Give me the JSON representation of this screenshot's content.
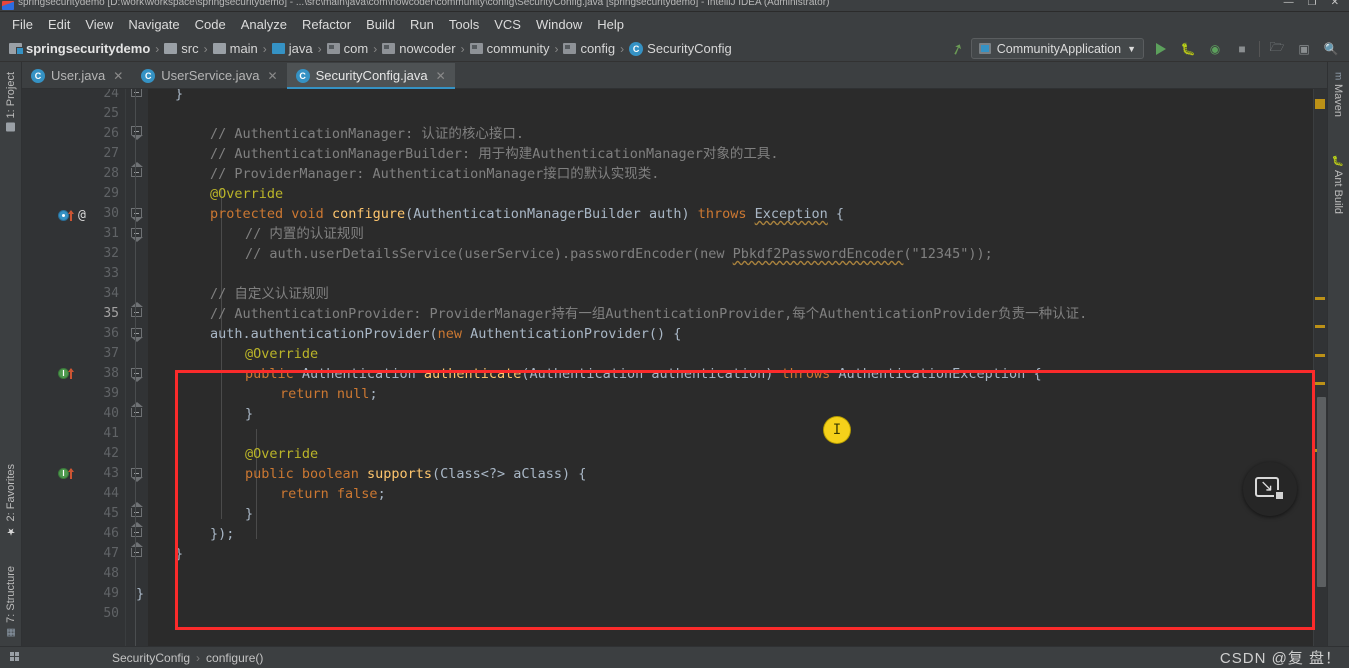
{
  "window": {
    "title": "springsecuritydemo [D:\\work\\workspace\\springsecuritydemo] - ...\\src\\main\\java\\com\\nowcoder\\community\\config\\SecurityConfig.java [springsecuritydemo] - IntelliJ IDEA (Administrator)",
    "minimize": "—",
    "maximize": "❐",
    "close": "✕"
  },
  "menu": [
    {
      "label": "File"
    },
    {
      "label": "Edit"
    },
    {
      "label": "View"
    },
    {
      "label": "Navigate"
    },
    {
      "label": "Code"
    },
    {
      "label": "Analyze"
    },
    {
      "label": "Refactor"
    },
    {
      "label": "Build"
    },
    {
      "label": "Run"
    },
    {
      "label": "Tools"
    },
    {
      "label": "VCS"
    },
    {
      "label": "Window"
    },
    {
      "label": "Help"
    }
  ],
  "breadcrumbs": [
    {
      "label": "springsecuritydemo",
      "icon": "project-folder-icon"
    },
    {
      "label": "src",
      "icon": "folder-icon"
    },
    {
      "label": "main",
      "icon": "folder-icon"
    },
    {
      "label": "java",
      "icon": "source-folder-icon"
    },
    {
      "label": "com",
      "icon": "package-icon"
    },
    {
      "label": "nowcoder",
      "icon": "package-icon"
    },
    {
      "label": "community",
      "icon": "package-icon"
    },
    {
      "label": "config",
      "icon": "package-icon"
    },
    {
      "label": "SecurityConfig",
      "icon": "class-icon"
    }
  ],
  "breadcrumb_separator": "›",
  "toolbar": {
    "build_icon": "hammer-icon",
    "run_config": "CommunityApplication",
    "run_config_caret": "▼",
    "run_icon": "run-icon",
    "debug_icon": "debug-icon",
    "coverage_icon": "run-with-coverage-icon",
    "stop_icon": "stop-icon",
    "project_structure_icon": "project-structure-icon",
    "terminal_icon": "terminal-icon",
    "search_icon": "search-everywhere-icon"
  },
  "tabs": [
    {
      "label": "User.java",
      "active": false,
      "close": "✕",
      "badge": "C"
    },
    {
      "label": "UserService.java",
      "active": false,
      "close": "✕",
      "badge": "C"
    },
    {
      "label": "SecurityConfig.java",
      "active": true,
      "close": "✕",
      "badge": "C"
    }
  ],
  "left_tool_window": [
    {
      "label": "1: Project",
      "icon": "project-icon"
    },
    {
      "label": "2: Favorites",
      "icon": "star-icon"
    },
    {
      "label": "7: Structure",
      "icon": "structure-icon"
    }
  ],
  "right_tool_window": [
    {
      "label": "Maven",
      "icon": "maven-icon"
    },
    {
      "label": "Ant Build",
      "icon": "ant-icon"
    }
  ],
  "editor": {
    "first_line": 24,
    "last_line": 50,
    "current_line": 35,
    "line_numbers": [
      24,
      25,
      26,
      27,
      28,
      29,
      30,
      31,
      32,
      33,
      34,
      35,
      36,
      37,
      38,
      39,
      40,
      41,
      42,
      43,
      44,
      45,
      46,
      47,
      48,
      49,
      50
    ],
    "gutter_marks": [
      {
        "line": 30,
        "icon": "override-method-icon"
      },
      {
        "line": 38,
        "icon": "implementing-method-icon"
      },
      {
        "line": 43,
        "icon": "implementing-method-icon"
      }
    ],
    "lines": [
      {
        "n": 24,
        "indent": 1,
        "text": "}"
      },
      {
        "n": 25,
        "indent": 0,
        "text": ""
      },
      {
        "n": 26,
        "indent": 2,
        "text": "// AuthenticationManager: 认证的核心接口."
      },
      {
        "n": 27,
        "indent": 2,
        "text": "// AuthenticationManagerBuilder: 用于构建AuthenticationManager对象的工具."
      },
      {
        "n": 28,
        "indent": 2,
        "text": "// ProviderManager: AuthenticationManager接口的默认实现类."
      },
      {
        "n": 29,
        "indent": 2,
        "text": "@Override"
      },
      {
        "n": 30,
        "indent": 2,
        "text": "protected void configure(AuthenticationManagerBuilder auth) throws Exception {"
      },
      {
        "n": 31,
        "indent": 3,
        "text": "// 内置的认证规则"
      },
      {
        "n": 32,
        "indent": 3,
        "text": "// auth.userDetailsService(userService).passwordEncoder(new Pbkdf2PasswordEncoder(\"12345\"));"
      },
      {
        "n": 33,
        "indent": 0,
        "text": ""
      },
      {
        "n": 34,
        "indent": 3,
        "text": "// 自定义认证规则"
      },
      {
        "n": 35,
        "indent": 3,
        "text": "// AuthenticationProvider: ProviderManager持有一组AuthenticationProvider,每个AuthenticationProvider负责一种认证."
      },
      {
        "n": 36,
        "indent": 3,
        "text": "auth.authenticationProvider(new AuthenticationProvider() {"
      },
      {
        "n": 37,
        "indent": 4,
        "text": "@Override"
      },
      {
        "n": 38,
        "indent": 4,
        "text": "public Authentication authenticate(Authentication authentication) throws AuthenticationException {"
      },
      {
        "n": 39,
        "indent": 5,
        "text": "return null;"
      },
      {
        "n": 40,
        "indent": 4,
        "text": "}"
      },
      {
        "n": 41,
        "indent": 0,
        "text": ""
      },
      {
        "n": 42,
        "indent": 4,
        "text": "@Override"
      },
      {
        "n": 43,
        "indent": 4,
        "text": "public boolean supports(Class<?> aClass) {"
      },
      {
        "n": 44,
        "indent": 5,
        "text": "return false;"
      },
      {
        "n": 45,
        "indent": 4,
        "text": "}"
      },
      {
        "n": 46,
        "indent": 3,
        "text": "});"
      },
      {
        "n": 47,
        "indent": 2,
        "text": "}"
      },
      {
        "n": 48,
        "indent": 0,
        "text": ""
      },
      {
        "n": 49,
        "indent": 1,
        "text": "}"
      },
      {
        "n": 50,
        "indent": 0,
        "text": ""
      }
    ],
    "annotation_box_color": "#fb2b2b",
    "cursor_icon": "text-ibeam-cursor"
  },
  "marker_bar": {
    "warning_color": "#bc9117",
    "markers": [
      14,
      212,
      240,
      270,
      297,
      363
    ]
  },
  "floating_button": {
    "icon": "preview-pane-icon"
  },
  "status_bar": {
    "breadcrumb": [
      {
        "label": "SecurityConfig"
      },
      {
        "label": "configure()"
      }
    ],
    "separator": "›",
    "watermark": "CSDN @复 盘！"
  }
}
